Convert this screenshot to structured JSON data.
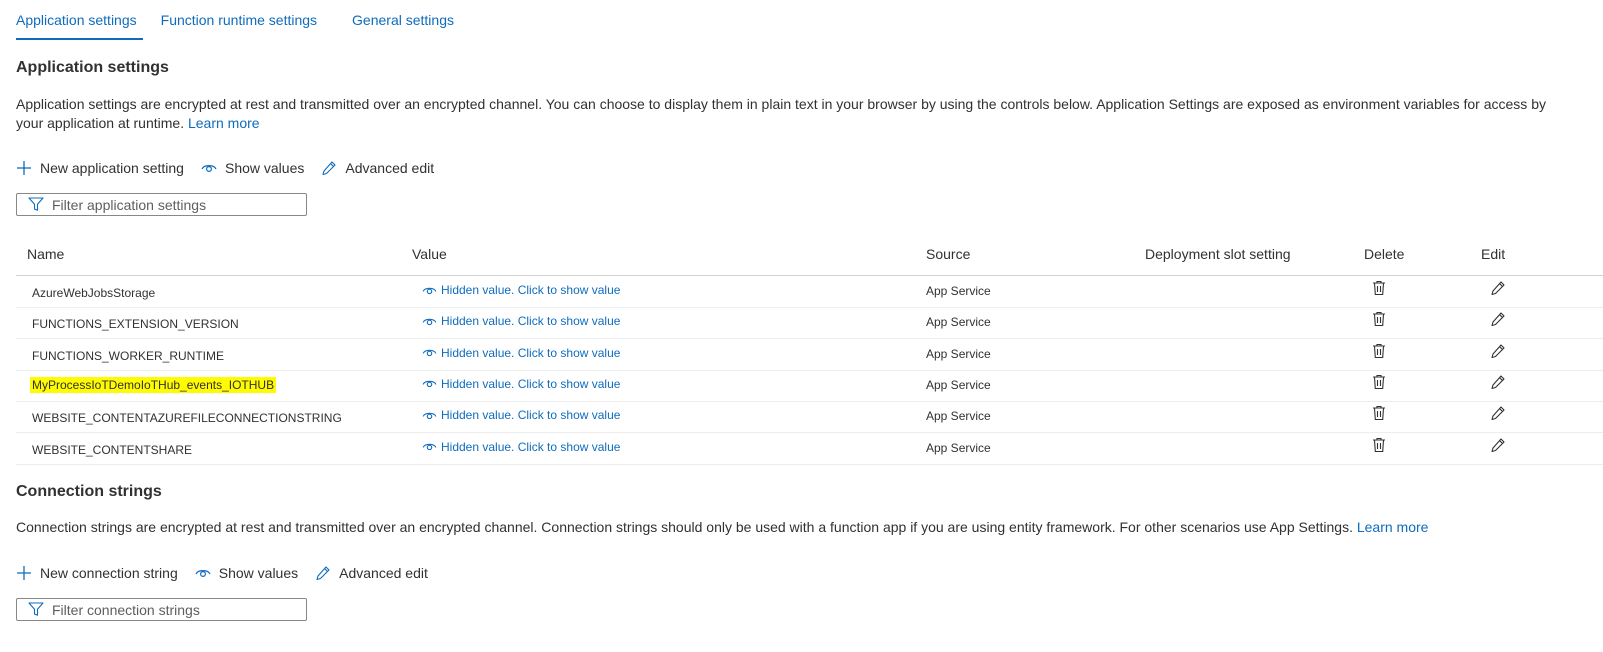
{
  "tabs": [
    {
      "label": "Application settings"
    },
    {
      "label": "Function runtime settings"
    },
    {
      "label": "General settings"
    }
  ],
  "app_settings": {
    "title": "Application settings",
    "description": "Application settings are encrypted at rest and transmitted over an encrypted channel. You can choose to display them in plain text in your browser by using the controls below. Application Settings are exposed as environment variables for access by your application at runtime.",
    "learn_more": "Learn more",
    "toolbar": {
      "new_label": "New application setting",
      "show_values_label": "Show values",
      "advanced_edit_label": "Advanced edit"
    },
    "filter_placeholder": "Filter application settings",
    "columns": {
      "name": "Name",
      "value": "Value",
      "source": "Source",
      "slot": "Deployment slot setting",
      "delete": "Delete",
      "edit": "Edit"
    },
    "rows": [
      {
        "name": "AzureWebJobsStorage",
        "value": "Hidden value. Click to show value",
        "source": "App Service"
      },
      {
        "name": "FUNCTIONS_EXTENSION_VERSION",
        "value": "Hidden value. Click to show value",
        "source": "App Service"
      },
      {
        "name": "FUNCTIONS_WORKER_RUNTIME",
        "value": "Hidden value. Click to show value",
        "source": "App Service"
      },
      {
        "name": "MyProcessIoTDemoIoTHub_events_IOTHUB",
        "value": "Hidden value. Click to show value",
        "source": "App Service"
      },
      {
        "name": "WEBSITE_CONTENTAZUREFILECONNECTIONSTRING",
        "value": "Hidden value. Click to show value",
        "source": "App Service"
      },
      {
        "name": "WEBSITE_CONTENTSHARE",
        "value": "Hidden value. Click to show value",
        "source": "App Service"
      }
    ],
    "highlight_color": "#fffb00"
  },
  "conn_strings": {
    "title": "Connection strings",
    "description": "Connection strings are encrypted at rest and transmitted over an encrypted channel. Connection strings should only be used with a function app if you are using entity framework. For other scenarios use App Settings.",
    "learn_more": "Learn more",
    "toolbar": {
      "new_label": "New connection string",
      "show_values_label": "Show values",
      "advanced_edit_label": "Advanced edit"
    },
    "filter_placeholder": "Filter connection strings"
  },
  "colors": {
    "accent": "#0f6cbd",
    "text": "#323130"
  }
}
